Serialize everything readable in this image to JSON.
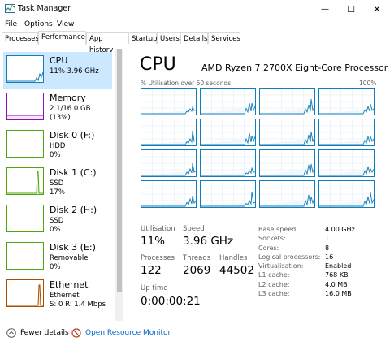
{
  "window": {
    "title": "Task Manager",
    "minimize_glyph": "—",
    "maximize_glyph": "☐",
    "close_glyph": "✕"
  },
  "menu": [
    "File",
    "Options",
    "View"
  ],
  "tabs": [
    "Processes",
    "Performance",
    "App history",
    "Startup",
    "Users",
    "Details",
    "Services"
  ],
  "active_tab": "Performance",
  "sidebar": [
    {
      "name": "CPU",
      "line1": "11% 3.96 GHz",
      "line2": "",
      "color": "#117dbb",
      "selected": true
    },
    {
      "name": "Memory",
      "line1": "2.1/16.0 GB (13%)",
      "line2": "",
      "color": "#8b12ae",
      "selected": false
    },
    {
      "name": "Disk 0 (F:)",
      "line1": "HDD",
      "line2": "0%",
      "color": "#4da60c",
      "selected": false
    },
    {
      "name": "Disk 1 (C:)",
      "line1": "SSD",
      "line2": "17%",
      "color": "#4da60c",
      "selected": false
    },
    {
      "name": "Disk 2 (H:)",
      "line1": "SSD",
      "line2": "0%",
      "color": "#4da60c",
      "selected": false
    },
    {
      "name": "Disk 3 (E:)",
      "line1": "Removable",
      "line2": "0%",
      "color": "#4da60c",
      "selected": false
    },
    {
      "name": "Ethernet",
      "line1": "Ethernet",
      "line2": "S: 0 R: 1.4 Mbps",
      "color": "#a74f01",
      "selected": false
    }
  ],
  "main": {
    "title": "CPU",
    "model": "AMD Ryzen 7 2700X Eight-Core Processor",
    "graph_caption": "% Utilisation over 60 seconds",
    "graph_max": "100%",
    "core_graph_count": 16,
    "stats": {
      "utilisation_label": "Utilisation",
      "utilisation": "11%",
      "speed_label": "Speed",
      "speed": "3.96 GHz",
      "processes_label": "Processes",
      "processes": "122",
      "threads_label": "Threads",
      "threads": "2069",
      "handles_label": "Handles",
      "handles": "44502",
      "uptime_label": "Up time",
      "uptime": "0:00:00:21"
    },
    "specs": [
      {
        "label": "Base speed:",
        "value": "4.00 GHz"
      },
      {
        "label": "Sockets:",
        "value": "1"
      },
      {
        "label": "Cores:",
        "value": "8"
      },
      {
        "label": "Logical processors:",
        "value": "16"
      },
      {
        "label": "Virtualisation:",
        "value": "Enabled"
      },
      {
        "label": "L1 cache:",
        "value": "768 KB"
      },
      {
        "label": "L2 cache:",
        "value": "4.0 MB"
      },
      {
        "label": "L3 cache:",
        "value": "16.0 MB"
      }
    ]
  },
  "footer": {
    "fewer_details": "Fewer details",
    "resource_monitor": "Open Resource Monitor"
  },
  "icons": [
    "task-manager-icon",
    "chevron-up-icon",
    "resource-monitor-icon"
  ]
}
